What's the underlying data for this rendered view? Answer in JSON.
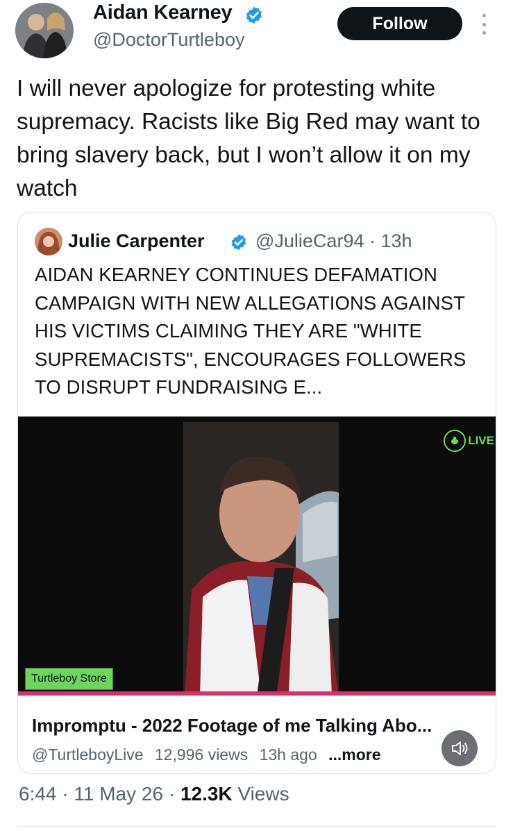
{
  "author": {
    "name": "Aidan Kearney",
    "handle": "@DoctorTurtleboy",
    "follow_label": "Follow"
  },
  "tweet": {
    "text": "I will never apologize for protesting white supremacy. Racists like Big Red may want to bring slavery back, but I won’t allow it on my watch"
  },
  "quoted_tweet": {
    "name": "Julie Carpenter",
    "handle": "@JulieCar94",
    "age": "· 13h",
    "text": "AIDAN KEARNEY CONTINUES DEFAMATION CAMPAIGN WITH NEW ALLEGATIONS AGAINST HIS VICTIMS CLAIMING THEY ARE \"WHITE SUPREMACISTS\", ENCOURAGES FOLLOWERS TO DISRUPT FUNDRAISING E..."
  },
  "video": {
    "live_label": "LIVE",
    "store_badge": "Turtleboy Store",
    "title": "Impromptu  - 2022 Footage of me Talking Abo...",
    "channel": "@TurtleboyLive",
    "views": "12,996 views",
    "age": "13h ago",
    "more": "...more"
  },
  "footer": {
    "time": "6:44",
    "date": "· 11 May 26 ·",
    "views_count": "12.3K",
    "views_label": "Views"
  },
  "colors": {
    "verified": "#1d9bf0",
    "follow_bg": "#0f1419",
    "secondary_text": "#536471",
    "live_green": "#6cdb4a",
    "store_green": "#6cd65b",
    "progress": "#d6336c"
  }
}
